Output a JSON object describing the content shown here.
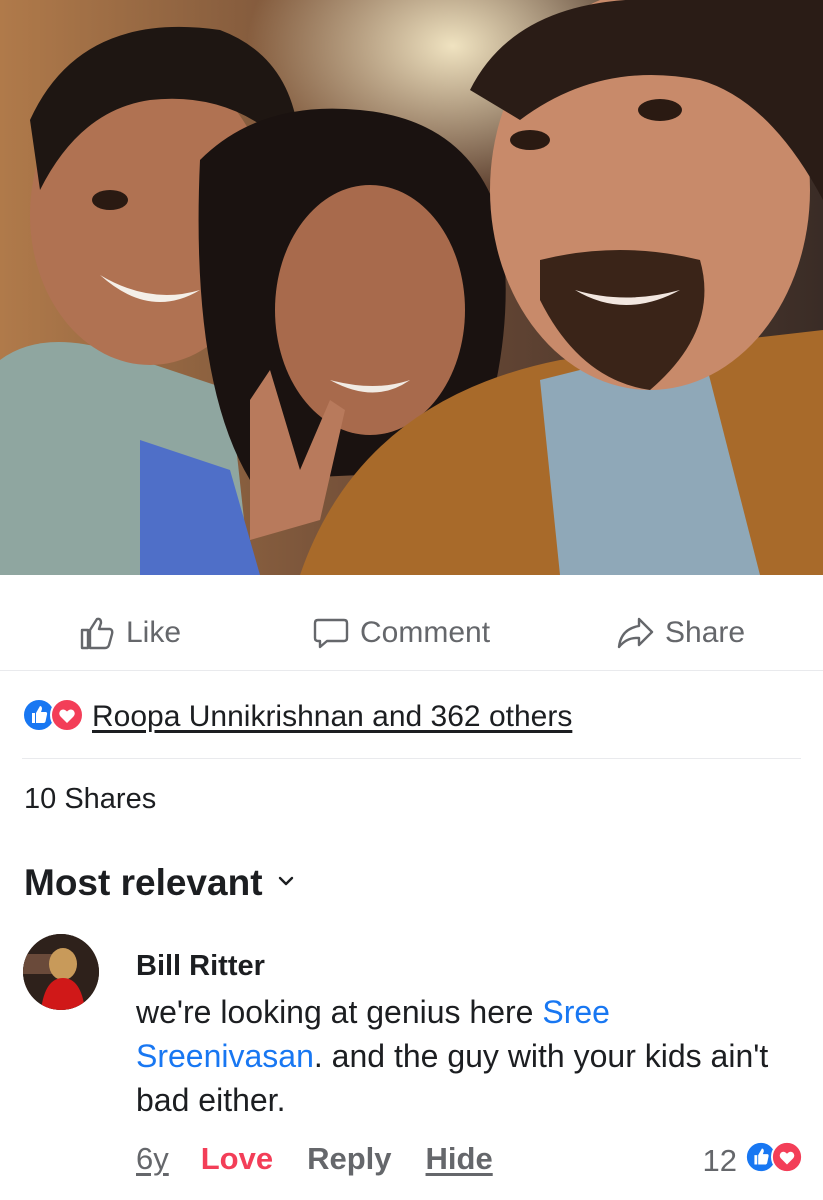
{
  "photo": {
    "subject_icon": "photo-icon"
  },
  "actions": {
    "like_label": "Like",
    "comment_label": "Comment",
    "share_label": "Share"
  },
  "reactions": {
    "summary": "Roopa Unnikrishnan and 362 others",
    "icons": [
      "like-reaction-icon",
      "love-reaction-icon"
    ]
  },
  "shares": {
    "text": "10 Shares"
  },
  "sort": {
    "label": "Most relevant"
  },
  "comment": {
    "author": "Bill Ritter",
    "text_before": "we're looking at genius here ",
    "mention": "Sree Sreenivasan",
    "text_after": ".  and the guy with your kids ain't bad either.",
    "time": "6y",
    "love_label": "Love",
    "reply_label": "Reply",
    "hide_label": "Hide",
    "reaction_count": "12"
  },
  "colors": {
    "like_blue": "#1877f2",
    "love_red": "#f33e58",
    "text_primary": "#1c1e21",
    "text_secondary": "#65676b",
    "divider": "#e9eaed"
  }
}
